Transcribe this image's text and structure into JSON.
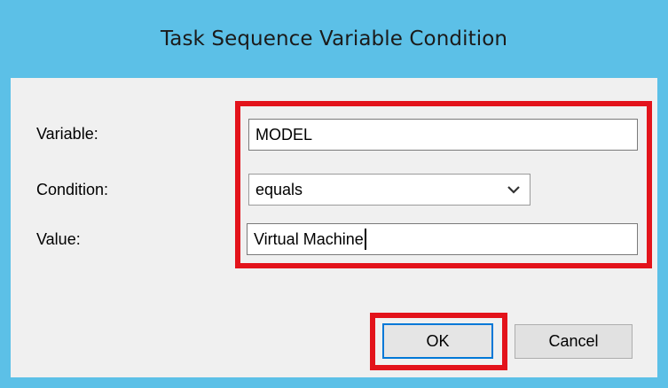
{
  "dialog": {
    "title": "Task Sequence Variable Condition"
  },
  "form": {
    "variable_label": "Variable:",
    "variable_value": "MODEL",
    "condition_label": "Condition:",
    "condition_value": "equals",
    "condition_icon": "chevron-down-icon",
    "value_label": "Value:",
    "value_value": "Virtual Machine"
  },
  "buttons": {
    "ok_label": "OK",
    "cancel_label": "Cancel"
  },
  "colors": {
    "titlebar": "#5cc0e7",
    "client": "#f0f0f0",
    "highlight": "#e3131b",
    "default_button_border": "#0078d7"
  }
}
